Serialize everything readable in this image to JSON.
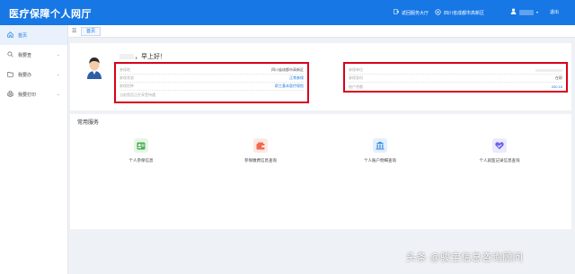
{
  "header": {
    "title": "医疗保障个人网厅",
    "hall_link": "返回服务大厅",
    "region": "四川省成都市高新区",
    "logout": "退出"
  },
  "sidebar": {
    "items": [
      {
        "label": "首页",
        "icon": "home-icon",
        "active": true
      },
      {
        "label": "我要查",
        "icon": "search-icon",
        "active": false
      },
      {
        "label": "我要办",
        "icon": "folder-icon",
        "active": false
      },
      {
        "label": "我要打印",
        "icon": "printer-icon",
        "active": false
      }
    ]
  },
  "tabs": {
    "home_tab": "首页"
  },
  "profile": {
    "greeting": "，早上好！",
    "left_rows": [
      {
        "label": "参保地",
        "value": "四川省成都市高新区",
        "highlight": false
      },
      {
        "label": "参保状态",
        "value": "正常参保",
        "highlight": true
      },
      {
        "label": "参保险种",
        "value": "职工基本医疗保险",
        "highlight": true
      },
      {
        "label": "当前是否正在享受待遇",
        "value": "",
        "highlight": false
      }
    ],
    "right_rows": [
      {
        "label": "参保单位",
        "value": "",
        "highlight": false
      },
      {
        "label": "参保身份",
        "value": "在职",
        "highlight": false
      },
      {
        "label": "账户余额",
        "value": "200.16",
        "highlight": true
      }
    ]
  },
  "services": {
    "title": "常用服务",
    "items": [
      {
        "label": "个人参保信息",
        "icon": "id-card-icon",
        "color": "#4caf50",
        "bg": "#e6f5e8"
      },
      {
        "label": "参保缴费信息查询",
        "icon": "wallet-icon",
        "color": "#f26b4f",
        "bg": "#fde9e4"
      },
      {
        "label": "个人账户明细查询",
        "icon": "building-icon",
        "color": "#3a8ee6",
        "bg": "#e4effb"
      },
      {
        "label": "个人就医记录信息查询",
        "icon": "heart-check-icon",
        "color": "#6b63e8",
        "bg": "#ebeafc"
      }
    ]
  },
  "watermark": "头条 @骏宝信息咨询顾问",
  "colors": {
    "brand": "#1677e5",
    "highlight_border": "#d9001b"
  }
}
